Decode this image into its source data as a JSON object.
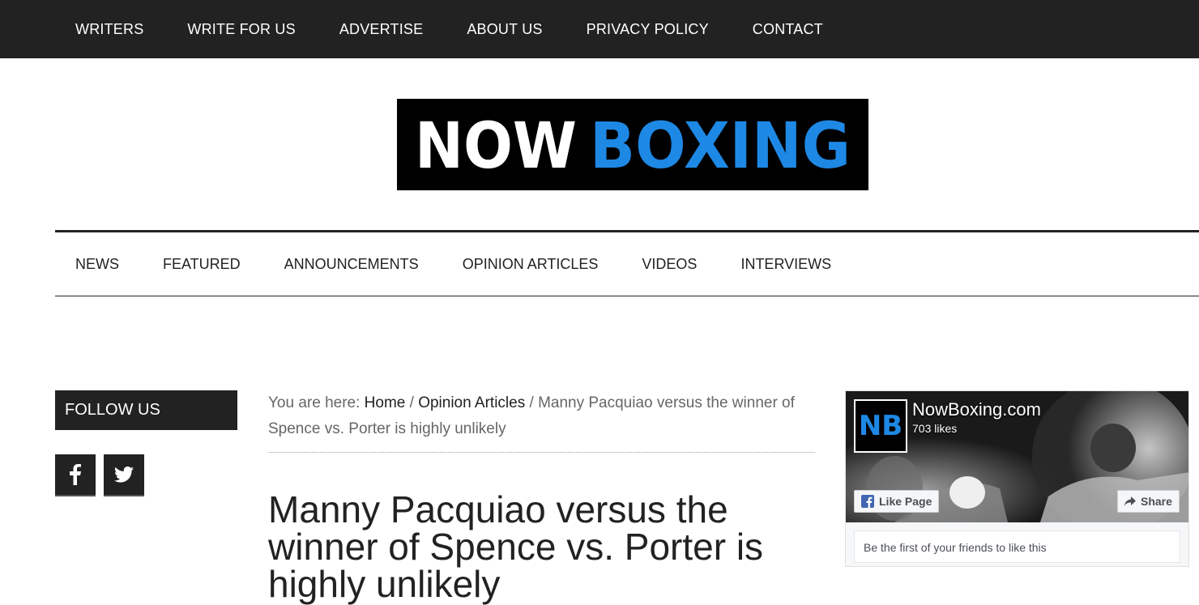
{
  "top_nav": {
    "items": [
      {
        "label": "WRITERS"
      },
      {
        "label": "WRITE FOR US"
      },
      {
        "label": "ADVERTISE"
      },
      {
        "label": "ABOUT US"
      },
      {
        "label": "PRIVACY POLICY"
      },
      {
        "label": "CONTACT"
      }
    ]
  },
  "logo": {
    "word1": "NOW",
    "word2": "BOXING",
    "colors": {
      "background": "#000000",
      "word1": "#ffffff",
      "word2": "#1e88e5"
    }
  },
  "main_nav": {
    "items": [
      {
        "label": "NEWS"
      },
      {
        "label": "FEATURED"
      },
      {
        "label": "ANNOUNCEMENTS"
      },
      {
        "label": "OPINION ARTICLES"
      },
      {
        "label": "VIDEOS"
      },
      {
        "label": "INTERVIEWS"
      }
    ]
  },
  "sidebar": {
    "follow_title": "FOLLOW US",
    "social": [
      {
        "icon": "facebook-icon"
      },
      {
        "icon": "twitter-icon"
      }
    ]
  },
  "breadcrumb": {
    "prefix": "You are here: ",
    "home": "Home",
    "sep": " / ",
    "category": "Opinion Articles",
    "current": "Manny Pacquiao versus the winner of Spence vs. Porter is highly unlikely"
  },
  "article": {
    "title": "Manny Pacquiao versus the winner of Spence vs. Porter is highly unlikely"
  },
  "facebook_widget": {
    "thumb_text": "NB",
    "page_name": "NowBoxing.com",
    "likes": "703 likes",
    "like_button": "Like Page",
    "share_button": "Share",
    "friends_text": "Be the first of your friends to like this"
  },
  "colors": {
    "topbar": "#222222",
    "accent_blue": "#1e88e5",
    "facebook_blue": "#4267b2"
  }
}
